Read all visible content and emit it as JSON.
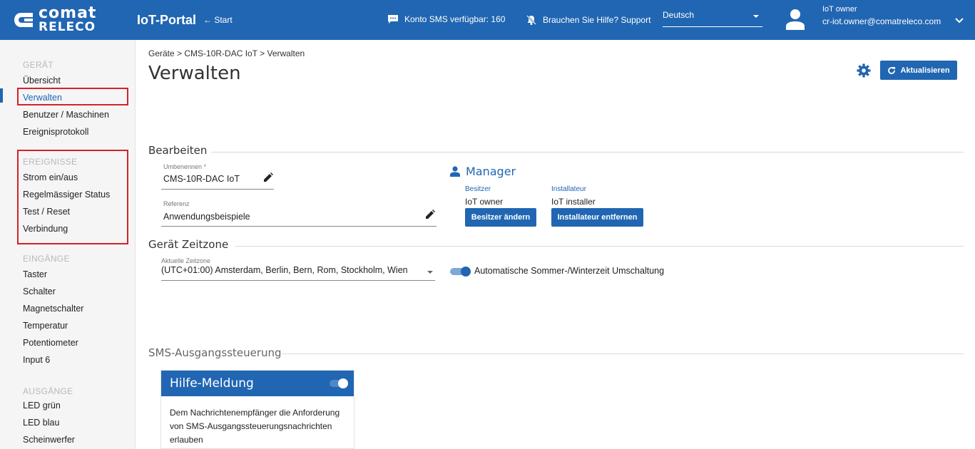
{
  "header": {
    "logo_line1": "comat",
    "logo_line2": "RELECO",
    "app_title": "IoT-Portal",
    "start_link": "← Start",
    "sms_info": "Konto SMS verfügbar: 160",
    "help_info": "Brauchen Sie Hilfe? Support",
    "language": "Deutsch",
    "user_name": "IoT owner",
    "user_email": "cr-iot.owner@comatreleco.com"
  },
  "sidebar": {
    "sections": {
      "device": "GERÄT",
      "events": "EREIGNISSE",
      "inputs": "EINGÄNGE",
      "outputs": "AUSGÄNGE"
    },
    "device_items": [
      "Übersicht",
      "Verwalten",
      "Benutzer / Maschinen",
      "Ereignisprotokoll"
    ],
    "event_items": [
      "Strom ein/aus",
      "Regelmässiger Status",
      "Test / Reset",
      "Verbindung"
    ],
    "input_items": [
      "Taster",
      "Schalter",
      "Magnetschalter",
      "Temperatur",
      "Potentiometer",
      "Input 6"
    ],
    "output_items": [
      "LED grün",
      "LED blau",
      "Scheinwerfer"
    ]
  },
  "main": {
    "breadcrumb": "Geräte > CMS-10R-DAC IoT > Verwalten",
    "title": "Verwalten",
    "refresh_label": "Aktualisieren",
    "edit_section": {
      "title": "Bearbeiten",
      "rename_label": "Umbenennen *",
      "rename_value": "CMS-10R-DAC IoT",
      "reference_label": "Referenz",
      "reference_value": "Anwendungsbeispiele"
    },
    "manager": {
      "title": "Manager",
      "owner_label": "Besitzer",
      "owner_value": "IoT owner",
      "installer_label": "Installateur",
      "installer_value": "IoT installer",
      "change_owner_btn": "Besitzer ändern",
      "remove_installer_btn": "Installateur entfernen"
    },
    "timezone": {
      "title": "Gerät Zeitzone",
      "current_label": "Aktuelle Zeitzone",
      "current_value": "(UTC+01:00) Amsterdam, Berlin, Bern, Rom, Stockholm, Wien",
      "dst_label": "Automatische Sommer-/Winterzeit Umschaltung",
      "dst_enabled": true
    },
    "sms_control": {
      "title": "SMS-Ausgangssteuerung",
      "card_title": "Hilfe-Meldung",
      "card_enabled": true,
      "card_text": "Dem Nachrichtenempfänger die Anforderung von SMS-Ausgangssteuerungsnachrichten erlauben"
    }
  },
  "colors": {
    "brand": "#2166b2",
    "highlight": "#d3222a"
  }
}
